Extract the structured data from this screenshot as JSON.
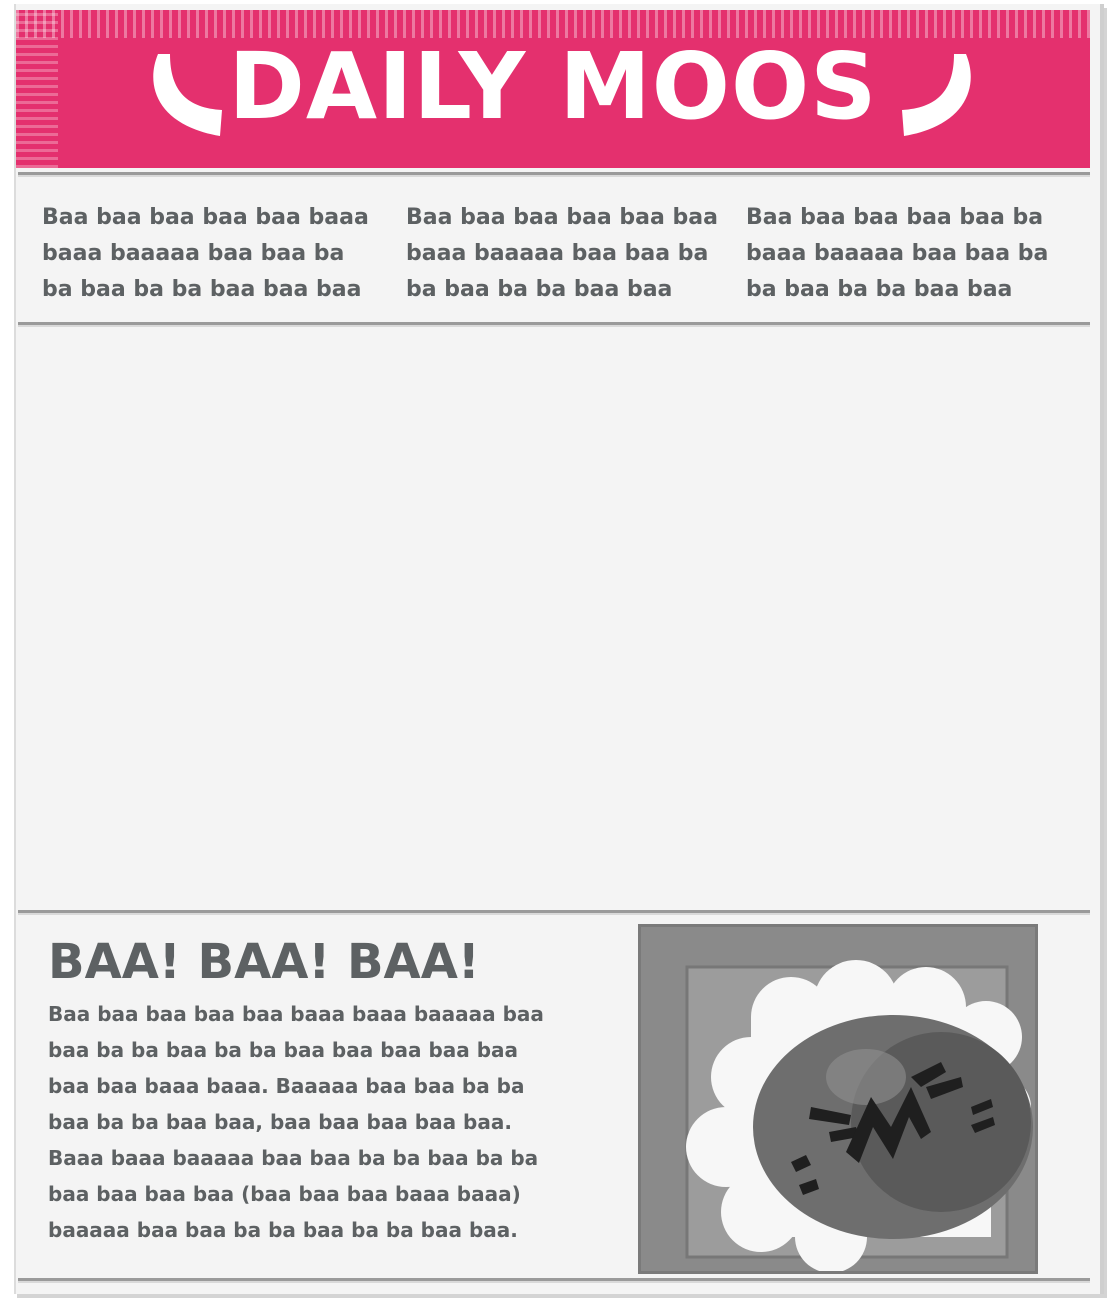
{
  "masthead": {
    "title": "DAILY MOOS",
    "color": "#e4306e"
  },
  "columns": [
    {
      "lines": [
        "Baa baa baa baa baa baaa",
        "baaa baaaaa baa baa ba",
        "ba baa ba ba  baa baa baa"
      ]
    },
    {
      "lines": [
        "Baa baa baa baa baa baa",
        "baaa baaaaa baa baa ba",
        "ba baa ba ba baa baa"
      ]
    },
    {
      "lines": [
        "Baa baa baa baa baa ba",
        "baaa baaaaa baa baa ba",
        "ba baa ba ba  baa baa"
      ]
    }
  ],
  "story": {
    "headline": "BAA! BAA! BAA!",
    "lines": [
      "Baa baa baa baa baa baaa baaa baaaaa baa",
      "baa ba ba baa ba ba  baa baa baa  baa baa",
      "baa baa baaa baaa. Baaaaa baa baa ba ba",
      "baa ba ba  baa baa, baa baa baa baa baa.",
      "Baaa baaa baaaaa baa baa ba ba baa ba ba",
      "baa baa baa baa (baa baa baa baaa baaa)",
      "baaaaa baa baa ba ba baa ba ba  baa baa."
    ],
    "photo_icon": "angry-sheep-icon"
  },
  "colors": {
    "text": "#5d6163",
    "paper": "#f4f4f4",
    "rule": "#9a9a9a"
  }
}
